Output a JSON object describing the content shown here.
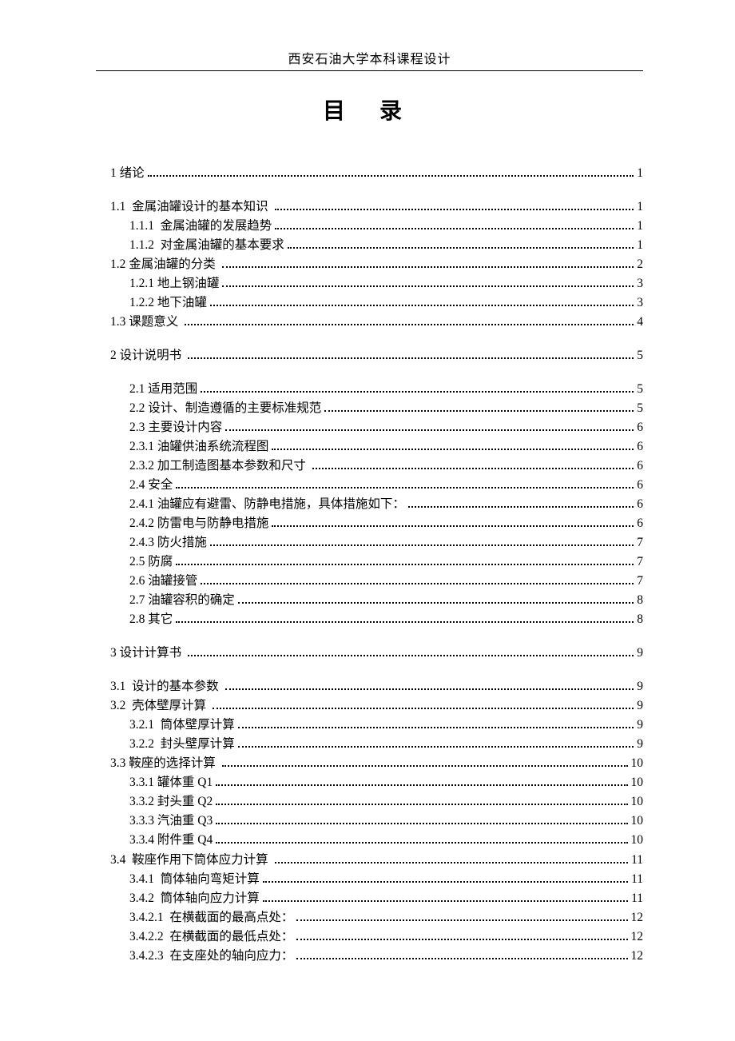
{
  "header": "西安石油大学本科课程设计",
  "title": "目  录",
  "toc": [
    {
      "level": 0,
      "label": "1 绪论",
      "page": "1",
      "gap": false
    },
    {
      "level": 1,
      "label": "1.1  金属油罐设计的基本知识 ",
      "page": "1",
      "gap": true
    },
    {
      "level": 2,
      "label": "1.1.1  金属油罐的发展趋势",
      "page": "1",
      "gap": false
    },
    {
      "level": 2,
      "label": "1.1.2  对金属油罐的基本要求",
      "page": "1",
      "gap": false
    },
    {
      "level": 1,
      "label": "1.2 金属油罐的分类 ",
      "page": "2",
      "gap": false
    },
    {
      "level": 2,
      "label": "1.2.1 地上钢油罐",
      "page": "3",
      "gap": false
    },
    {
      "level": 2,
      "label": "1.2.2 地下油罐",
      "page": "3",
      "gap": false
    },
    {
      "level": 1,
      "label": "1.3 课题意义 ",
      "page": "4",
      "gap": false
    },
    {
      "level": 0,
      "label": "2 设计说明书 ",
      "page": "5",
      "gap": true
    },
    {
      "level": 2,
      "label": "2.1 适用范围",
      "page": "5",
      "gap": true
    },
    {
      "level": 2,
      "label": "2.2 设计、制造遵循的主要标准规范",
      "page": "5",
      "gap": false
    },
    {
      "level": 2,
      "label": "2.3 主要设计内容",
      "page": "6",
      "gap": false
    },
    {
      "level": 2,
      "label": "2.3.1 油罐供油系统流程图",
      "page": "6",
      "gap": false
    },
    {
      "level": 2,
      "label": "2.3.2 加工制造图基本参数和尺寸 ",
      "page": "6",
      "gap": false
    },
    {
      "level": 2,
      "label": "2.4 安全",
      "page": "6",
      "gap": false
    },
    {
      "level": 2,
      "label": "2.4.1 油罐应有避雷、防静电措施，具体措施如下：",
      "page": "6",
      "gap": false
    },
    {
      "level": 2,
      "label": "2.4.2 防雷电与防静电措施",
      "page": "6",
      "gap": false
    },
    {
      "level": 2,
      "label": "2.4.3 防火措施",
      "page": "7",
      "gap": false
    },
    {
      "level": 2,
      "label": "2.5 防腐",
      "page": "7",
      "gap": false
    },
    {
      "level": 2,
      "label": "2.6 油罐接管",
      "page": "7",
      "gap": false
    },
    {
      "level": 2,
      "label": "2.7 油罐容积的确定",
      "page": "8",
      "gap": false
    },
    {
      "level": 2,
      "label": "2.8 其它",
      "page": "8",
      "gap": false
    },
    {
      "level": 0,
      "label": "3 设计计算书 ",
      "page": "9",
      "gap": true
    },
    {
      "level": 1,
      "label": "3.1  设计的基本参数 ",
      "page": "9",
      "gap": true
    },
    {
      "level": 1,
      "label": "3.2  壳体壁厚计算 ",
      "page": "9",
      "gap": false
    },
    {
      "level": 2,
      "label": "3.2.1  筒体壁厚计算",
      "page": " 9",
      "gap": false
    },
    {
      "level": 2,
      "label": "3.2.2  封头壁厚计算",
      "page": "9",
      "gap": false
    },
    {
      "level": 1,
      "label": "3.3 鞍座的选择计算 ",
      "page": "10",
      "gap": false
    },
    {
      "level": 2,
      "label": "3.3.1 罐体重 Q1",
      "page": "10",
      "gap": false
    },
    {
      "level": 2,
      "label": "3.3.2 封头重 Q2",
      "page": "10",
      "gap": false
    },
    {
      "level": 2,
      "label": "3.3.3 汽油重 Q3",
      "page": "10",
      "gap": false
    },
    {
      "level": 2,
      "label": "3.3.4 附件重 Q4",
      "page": "10",
      "gap": false
    },
    {
      "level": 1,
      "label": "3.4  鞍座作用下筒体应力计算 ",
      "page": "11",
      "gap": false
    },
    {
      "level": 2,
      "label": "3.4.1  筒体轴向弯矩计算",
      "page": "11",
      "gap": false
    },
    {
      "level": 2,
      "label": "3.4.2  筒体轴向应力计算",
      "page": "11",
      "gap": false
    },
    {
      "level": 2,
      "label": "3.4.2.1  在横截面的最高点处：",
      "page": "12",
      "gap": false
    },
    {
      "level": 2,
      "label": "3.4.2.2  在横截面的最低点处：",
      "page": "12",
      "gap": false
    },
    {
      "level": 2,
      "label": "3.4.2.3  在支座处的轴向应力：",
      "page": "12",
      "gap": false
    }
  ]
}
